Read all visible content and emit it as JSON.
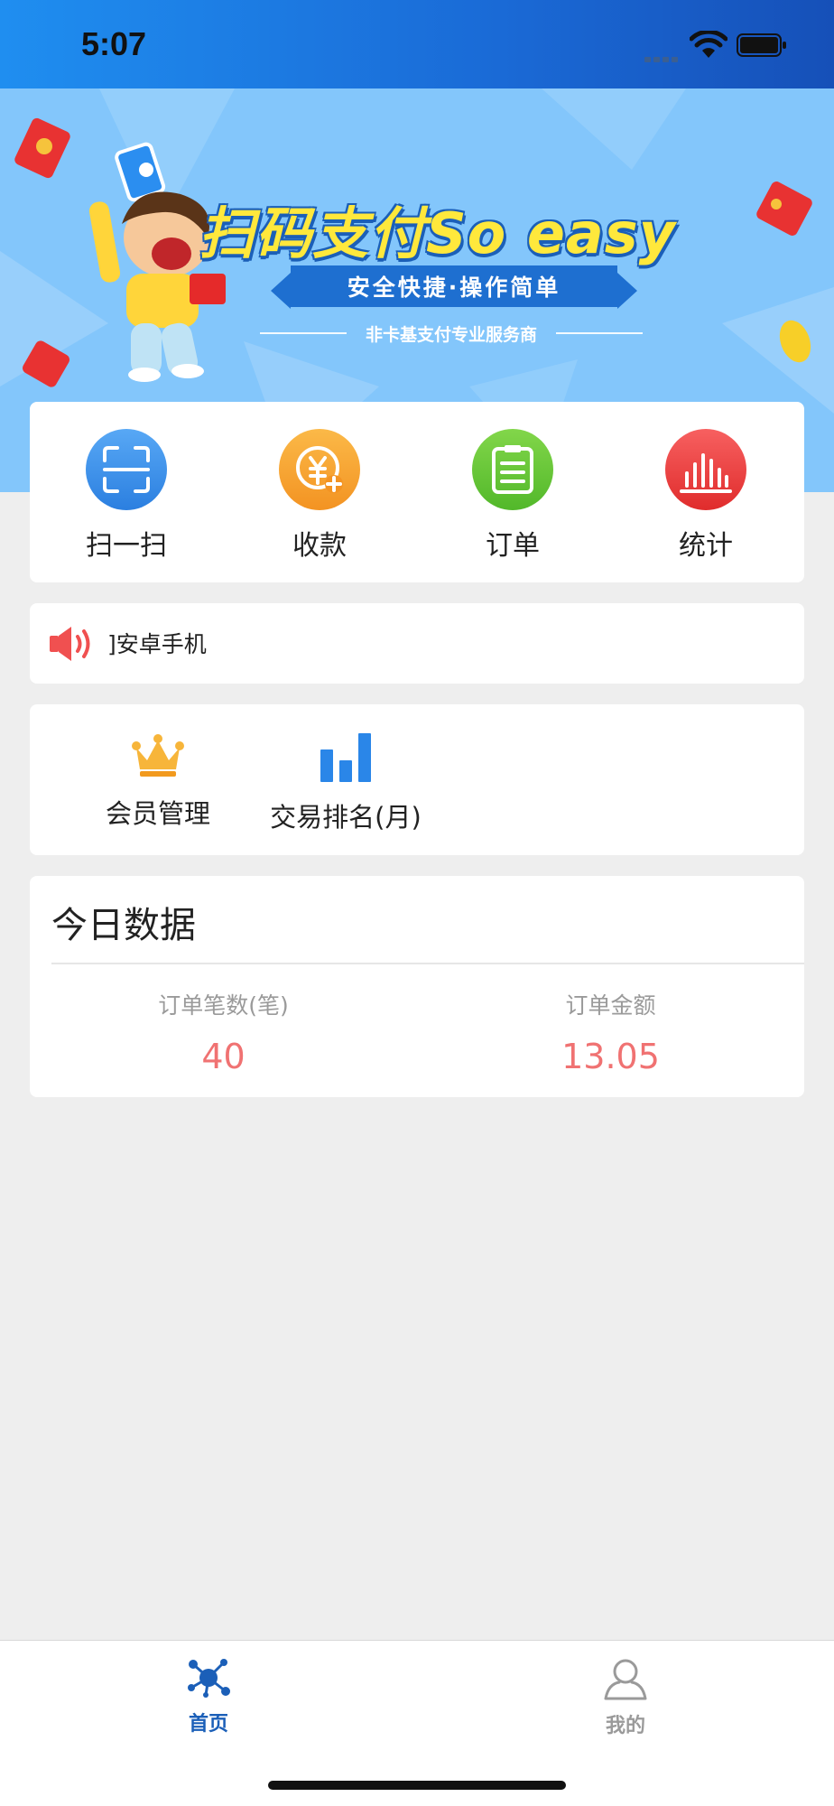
{
  "status_bar": {
    "time": "5:07"
  },
  "banner": {
    "title": "扫码支付So easy",
    "ribbon": "安全快捷·操作简单",
    "subtitle": "非卡基支付专业服务商"
  },
  "quick_actions": [
    {
      "label": "扫一扫",
      "icon": "scan-icon",
      "color": "#3a8fe8"
    },
    {
      "label": "收款",
      "icon": "yuan-receive-icon",
      "color": "#f7a534"
    },
    {
      "label": "订单",
      "icon": "clipboard-icon",
      "color": "#6ecb3a"
    },
    {
      "label": "统计",
      "icon": "bar-stats-icon",
      "color": "#f04848"
    }
  ],
  "notice": {
    "text": "]安卓手机",
    "icon": "speaker-icon"
  },
  "member_tools": [
    {
      "label": "会员管理",
      "icon": "crown-icon"
    },
    {
      "label": "交易排名(月)",
      "icon": "ranking-bars-icon"
    }
  ],
  "today_data": {
    "title": "今日数据",
    "order_count_label": "订单笔数(笔)",
    "order_count_value": "40",
    "order_amount_label": "订单金额",
    "order_amount_value": "13.05"
  },
  "tab_bar": [
    {
      "label": "首页",
      "icon": "home-network-icon",
      "active": true,
      "color": "#1b5fb8"
    },
    {
      "label": "我的",
      "icon": "user-profile-icon",
      "active": false,
      "color": "#9a9a9a"
    }
  ]
}
